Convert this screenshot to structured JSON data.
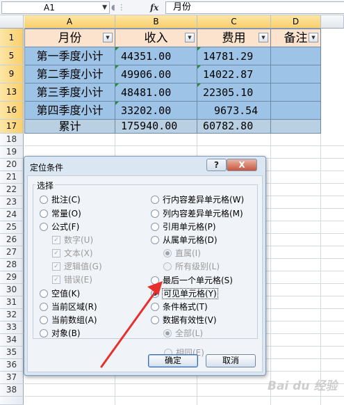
{
  "formula_bar": {
    "name_box": "A1",
    "fx_label": "fx",
    "value": "月份"
  },
  "columns": [
    "A",
    "B",
    "C",
    "D"
  ],
  "rows": [
    "1",
    "5",
    "9",
    "13",
    "16",
    "17",
    "18",
    "19",
    "20",
    "21",
    "22",
    "23",
    "24",
    "25",
    "26",
    "27",
    "28",
    "29",
    "30",
    "31",
    "32",
    "33",
    "34",
    "35",
    "36",
    "37",
    "38"
  ],
  "table": {
    "headers": [
      "月份",
      "收入",
      "费用",
      "备注"
    ],
    "body": [
      [
        "第一季度小计",
        "44351.00",
        "14781.29",
        ""
      ],
      [
        "第二季度小计",
        "49906.00",
        "14022.87",
        ""
      ],
      [
        "第三季度小计",
        "48481.00",
        "22305.10",
        ""
      ],
      [
        "第四季度小计",
        "33202.00",
        "9673.54",
        ""
      ],
      [
        "累计",
        "175940.00",
        "60782.80",
        ""
      ]
    ]
  },
  "dialog": {
    "title": "定位条件",
    "help_label": "?",
    "close_label": "X",
    "group_label": "选择",
    "left_options": [
      {
        "label": "批注(C)",
        "selected": false
      },
      {
        "label": "常量(O)",
        "selected": false
      },
      {
        "label": "公式(F)",
        "selected": false
      }
    ],
    "formula_subs": [
      {
        "label": "数字(U)"
      },
      {
        "label": "文本(X)"
      },
      {
        "label": "逻辑值(G)"
      },
      {
        "label": "错误(E)"
      }
    ],
    "left_options_2": [
      {
        "label": "空值(K)"
      },
      {
        "label": "当前区域(R)"
      },
      {
        "label": "当前数组(A)"
      },
      {
        "label": "对象(B)"
      }
    ],
    "right_options": [
      {
        "label": "行内容差异单元格(W)"
      },
      {
        "label": "列内容差异单元格(M)"
      },
      {
        "label": "引用单元格(P)"
      },
      {
        "label": "从属单元格(D)"
      }
    ],
    "dependents_subs": [
      {
        "label": "直属(I)",
        "selected": true
      },
      {
        "label": "所有级别(L)",
        "selected": false
      }
    ],
    "right_options_2": [
      {
        "label": "最后一个单元格(S)",
        "selected": false
      },
      {
        "label": "可见单元格(Y)",
        "selected": true
      },
      {
        "label": "条件格式(T)",
        "selected": false
      },
      {
        "label": "数据有效性(V)",
        "selected": false
      }
    ],
    "validation_subs": [
      {
        "label": "全部(L)",
        "selected": true
      },
      {
        "label": "相同(E)",
        "selected": false
      }
    ],
    "ok_label": "确定",
    "cancel_label": "取消"
  },
  "annotation_color": "#e8302a",
  "watermark": "Bai du 经验"
}
